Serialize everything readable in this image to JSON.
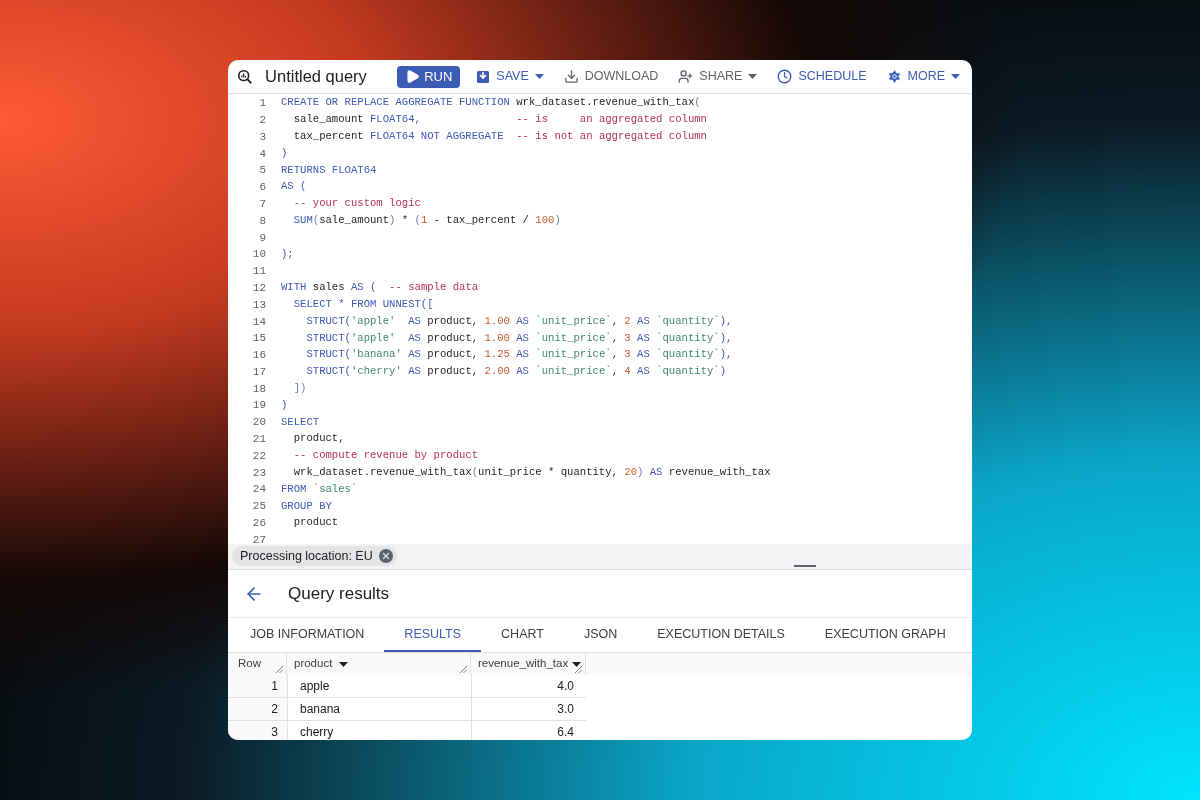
{
  "title": "Untitled query",
  "toolbar": [
    {
      "label": "RUN",
      "kind": "primary",
      "dropdown": false
    },
    {
      "label": "SAVE",
      "kind": "text",
      "dropdown": true
    },
    {
      "label": "DOWNLOAD",
      "kind": "plain",
      "dropdown": false
    },
    {
      "label": "SHARE",
      "kind": "plain",
      "dropdown": true
    },
    {
      "label": "SCHEDULE",
      "kind": "text",
      "dropdown": false
    },
    {
      "label": "MORE",
      "kind": "text",
      "dropdown": true
    }
  ],
  "editor": {
    "lines": [
      {
        "number": "1",
        "tokens": [
          {
            "kind": "kw",
            "text": "CREATE OR REPLACE AGGREGATE FUNCTION "
          },
          {
            "kind": "id",
            "text": "wrk_dataset.revenue_with_tax"
          },
          {
            "kind": "pu",
            "text": "("
          }
        ]
      },
      {
        "number": "2",
        "tokens": [
          {
            "kind": "id",
            "text": "  sale_amount "
          },
          {
            "kind": "kw",
            "text": "FLOAT64,               "
          },
          {
            "kind": "cm",
            "text": "-- is     an aggregated column"
          }
        ]
      },
      {
        "number": "3",
        "tokens": [
          {
            "kind": "id",
            "text": "  tax_percent "
          },
          {
            "kind": "kw",
            "text": "FLOAT64 NOT AGGREGATE  "
          },
          {
            "kind": "cm",
            "text": "-- is not an aggregated column"
          }
        ]
      },
      {
        "number": "4",
        "tokens": [
          {
            "kind": "kw",
            "text": ")"
          }
        ]
      },
      {
        "number": "5",
        "tokens": [
          {
            "kind": "kw",
            "text": "RETURNS FLOAT64"
          }
        ]
      },
      {
        "number": "6",
        "tokens": [
          {
            "kind": "kw",
            "text": "AS ("
          }
        ]
      },
      {
        "number": "7",
        "tokens": [
          {
            "kind": "cm",
            "text": "  -- your custom logic"
          }
        ]
      },
      {
        "number": "8",
        "tokens": [
          {
            "kind": "kw",
            "text": "  SUM"
          },
          {
            "kind": "pu",
            "text": "("
          },
          {
            "kind": "id",
            "text": "sale_amount"
          },
          {
            "kind": "pu",
            "text": ")"
          },
          {
            "kind": "id",
            "text": " * "
          },
          {
            "kind": "pu",
            "text": "("
          },
          {
            "kind": "num",
            "text": "1"
          },
          {
            "kind": "id",
            "text": " - tax_percent / "
          },
          {
            "kind": "num",
            "text": "100"
          },
          {
            "kind": "pu",
            "text": ")"
          }
        ]
      },
      {
        "number": "9"
      },
      {
        "number": "10",
        "tokens": [
          {
            "kind": "kw",
            "text": ");"
          }
        ]
      },
      {
        "number": "11"
      },
      {
        "number": "12",
        "tokens": [
          {
            "kind": "kw",
            "text": "WITH "
          },
          {
            "kind": "id",
            "text": "sales "
          },
          {
            "kind": "kw",
            "text": "AS (  "
          },
          {
            "kind": "cm",
            "text": "-- sample data"
          }
        ]
      },
      {
        "number": "13",
        "tokens": [
          {
            "kind": "kw",
            "text": "  SELECT * FROM UNNEST(["
          }
        ]
      },
      {
        "number": "14",
        "tokens": [
          {
            "kind": "kw",
            "text": "    STRUCT("
          },
          {
            "kind": "str",
            "text": "'apple'  "
          },
          {
            "kind": "kw",
            "text": "AS "
          },
          {
            "kind": "id",
            "text": "product, "
          },
          {
            "kind": "num",
            "text": "1.00"
          },
          {
            "kind": "kw",
            "text": " AS "
          },
          {
            "kind": "str",
            "text": "`unit_price`"
          },
          {
            "kind": "id",
            "text": ", "
          },
          {
            "kind": "num",
            "text": "2"
          },
          {
            "kind": "kw",
            "text": " AS "
          },
          {
            "kind": "str",
            "text": "`quantity`"
          },
          {
            "kind": "kw",
            "text": "),"
          }
        ]
      },
      {
        "number": "15",
        "tokens": [
          {
            "kind": "kw",
            "text": "    STRUCT("
          },
          {
            "kind": "str",
            "text": "'apple'  "
          },
          {
            "kind": "kw",
            "text": "AS "
          },
          {
            "kind": "id",
            "text": "product, "
          },
          {
            "kind": "num",
            "text": "1.00"
          },
          {
            "kind": "kw",
            "text": " AS "
          },
          {
            "kind": "str",
            "text": "`unit_price`"
          },
          {
            "kind": "id",
            "text": ", "
          },
          {
            "kind": "num",
            "text": "3"
          },
          {
            "kind": "kw",
            "text": " AS "
          },
          {
            "kind": "str",
            "text": "`quantity`"
          },
          {
            "kind": "kw",
            "text": "),"
          }
        ]
      },
      {
        "number": "16",
        "tokens": [
          {
            "kind": "kw",
            "text": "    STRUCT("
          },
          {
            "kind": "str",
            "text": "'banana' "
          },
          {
            "kind": "kw",
            "text": "AS "
          },
          {
            "kind": "id",
            "text": "product, "
          },
          {
            "kind": "num",
            "text": "1.25"
          },
          {
            "kind": "kw",
            "text": " AS "
          },
          {
            "kind": "str",
            "text": "`unit_price`"
          },
          {
            "kind": "id",
            "text": ", "
          },
          {
            "kind": "num",
            "text": "3"
          },
          {
            "kind": "kw",
            "text": " AS "
          },
          {
            "kind": "str",
            "text": "`quantity`"
          },
          {
            "kind": "kw",
            "text": "),"
          }
        ]
      },
      {
        "number": "17",
        "tokens": [
          {
            "kind": "kw",
            "text": "    STRUCT("
          },
          {
            "kind": "str",
            "text": "'cherry' "
          },
          {
            "kind": "kw",
            "text": "AS "
          },
          {
            "kind": "id",
            "text": "product, "
          },
          {
            "kind": "num",
            "text": "2.00"
          },
          {
            "kind": "kw",
            "text": " AS "
          },
          {
            "kind": "str",
            "text": "`unit_price`"
          },
          {
            "kind": "id",
            "text": ", "
          },
          {
            "kind": "num",
            "text": "4"
          },
          {
            "kind": "kw",
            "text": " AS "
          },
          {
            "kind": "str",
            "text": "`quantity`"
          },
          {
            "kind": "kw",
            "text": ")"
          }
        ]
      },
      {
        "number": "18",
        "tokens": [
          {
            "kind": "pu",
            "text": "  ])"
          }
        ]
      },
      {
        "number": "19",
        "tokens": [
          {
            "kind": "kw",
            "text": ")"
          }
        ]
      },
      {
        "number": "20",
        "tokens": [
          {
            "kind": "kw",
            "text": "SELECT"
          }
        ]
      },
      {
        "number": "21",
        "tokens": [
          {
            "kind": "id",
            "text": "  product,"
          }
        ]
      },
      {
        "number": "22",
        "tokens": [
          {
            "kind": "cm",
            "text": "  -- compute revenue by product"
          }
        ]
      },
      {
        "number": "23",
        "tokens": [
          {
            "kind": "id",
            "text": "  wrk_dataset.revenue_with_tax"
          },
          {
            "kind": "pu",
            "text": "("
          },
          {
            "kind": "id",
            "text": "unit_price * quantity, "
          },
          {
            "kind": "num",
            "text": "20"
          },
          {
            "kind": "pu",
            "text": ")"
          },
          {
            "kind": "kw",
            "text": " AS "
          },
          {
            "kind": "id",
            "text": "revenue_with_tax"
          }
        ]
      },
      {
        "number": "24",
        "tokens": [
          {
            "kind": "kw",
            "text": "FROM "
          },
          {
            "kind": "str",
            "text": "`sales`"
          }
        ]
      },
      {
        "number": "25",
        "tokens": [
          {
            "kind": "kw",
            "text": "GROUP BY"
          }
        ]
      },
      {
        "number": "26",
        "tokens": [
          {
            "kind": "id",
            "text": "  product"
          }
        ]
      },
      {
        "number": "27"
      }
    ]
  },
  "chip": {
    "label": "Processing location: EU"
  },
  "results": {
    "title": "Query results",
    "tabs": [
      {
        "label": "JOB INFORMATION",
        "selected": false
      },
      {
        "label": "RESULTS",
        "selected": true
      },
      {
        "label": "CHART",
        "selected": false
      },
      {
        "label": "JSON",
        "selected": false
      },
      {
        "label": "EXECUTION DETAILS",
        "selected": false
      },
      {
        "label": "EXECUTION GRAPH",
        "selected": false
      }
    ],
    "columns": [
      {
        "label": "Row",
        "sortable": false
      },
      {
        "label": "product",
        "sortable": true
      },
      {
        "label": "revenue_with_tax",
        "sortable": true
      }
    ],
    "rows": [
      [
        "1",
        "apple",
        "4.0"
      ],
      [
        "2",
        "banana",
        "3.0"
      ],
      [
        "3",
        "cherry",
        "6.4"
      ]
    ]
  }
}
